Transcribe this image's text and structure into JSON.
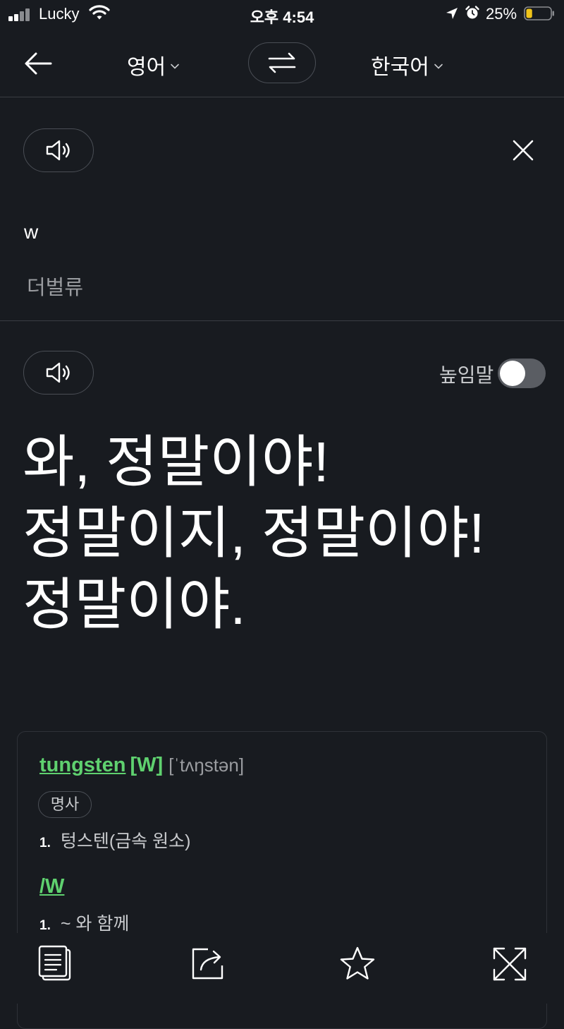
{
  "status_bar": {
    "carrier": "Lucky",
    "time": "오후 4:54",
    "battery_percent": "25%",
    "battery_level": 0.25,
    "icons": [
      "signal-icon",
      "wifi-icon",
      "location-icon",
      "alarm-icon",
      "battery-icon"
    ]
  },
  "header": {
    "source_language": "영어",
    "target_language": "한국어",
    "icons": [
      "back-arrow-icon",
      "swap-icon",
      "chevron-down-icon"
    ]
  },
  "source": {
    "text": "w",
    "pronunciation": "더벌류",
    "icons": [
      "speaker-icon",
      "close-icon"
    ]
  },
  "result": {
    "honorific_label": "높임말",
    "honorific_enabled": false,
    "translation_lines": [
      "와, 정말이야!",
      "정말이지, 정말이야!",
      "정말이야."
    ],
    "icons": [
      "speaker-icon"
    ]
  },
  "dictionary": {
    "entries": [
      {
        "word": "tungsten",
        "tag": "[W]",
        "pronunciation": "[ˈtʌŋstən]",
        "part_of_speech": "명사",
        "definitions": [
          {
            "number": "1.",
            "text": "텅스텐(금속 원소)"
          }
        ]
      },
      {
        "word": "/W",
        "definitions": [
          {
            "number": "1.",
            "text": "~ 와 함께"
          }
        ]
      }
    ]
  },
  "toolbar": {
    "icons": [
      "document-icon",
      "share-icon",
      "star-icon",
      "fullscreen-icon"
    ]
  },
  "colors": {
    "background": "#181b20",
    "accent_green": "#5fd16f",
    "muted_text": "#9a9ca0",
    "border": "#4a4e55"
  }
}
